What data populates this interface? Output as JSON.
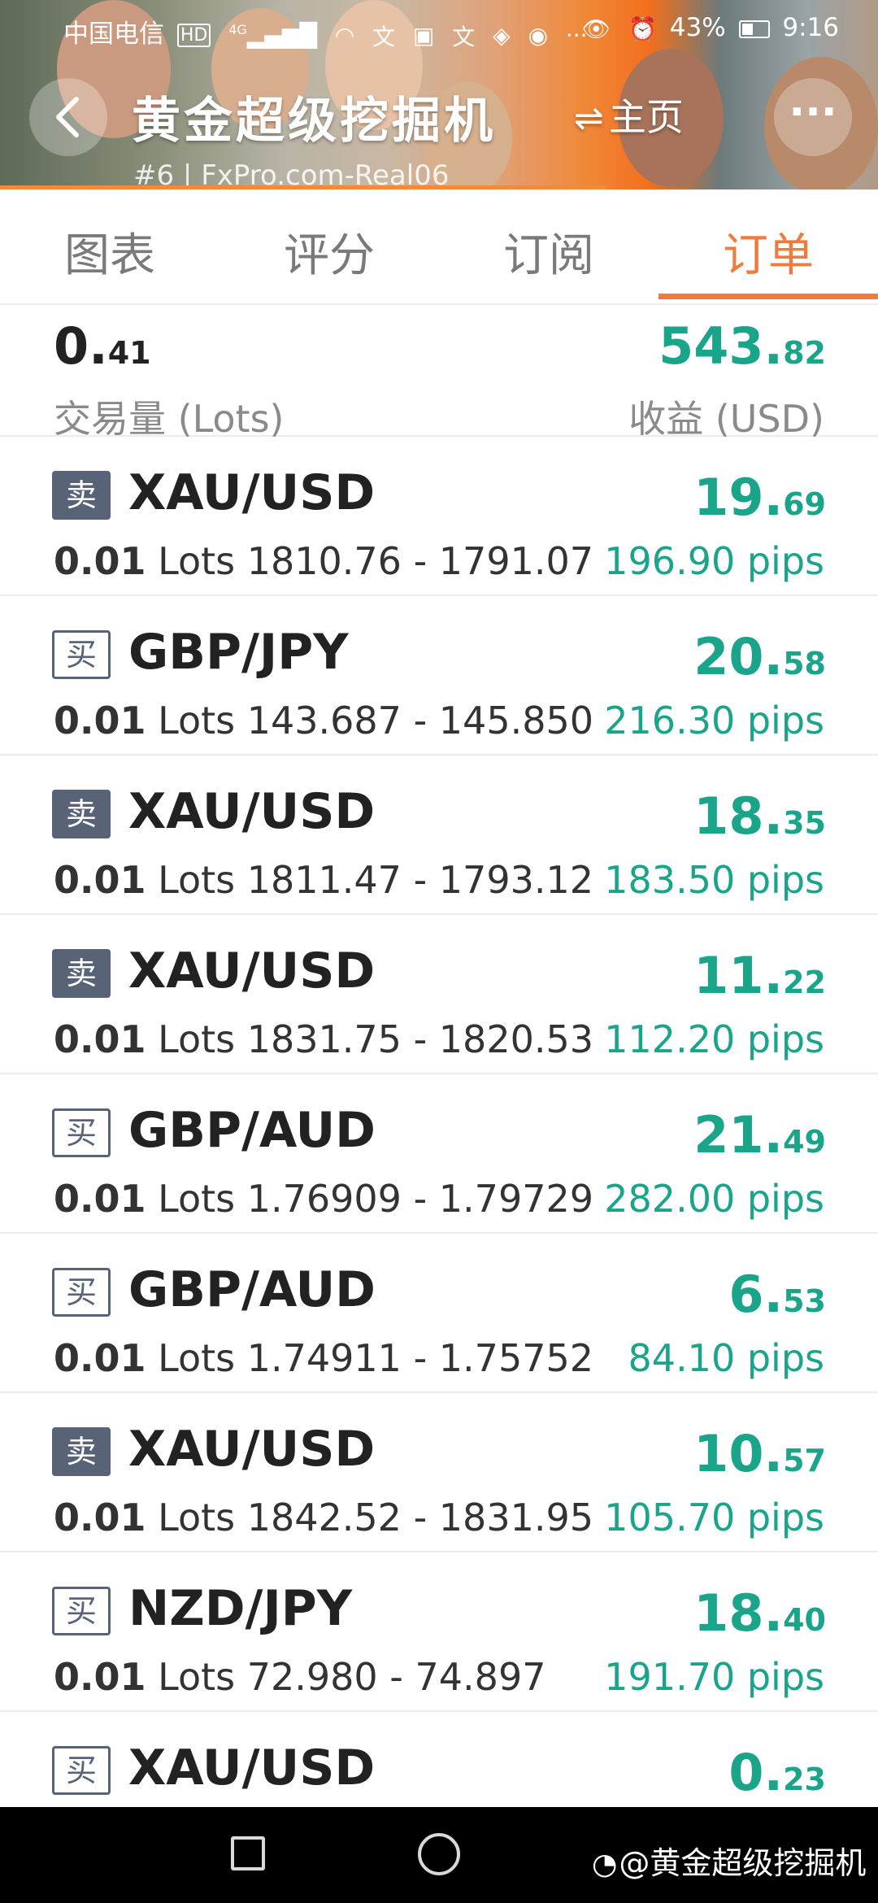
{
  "status_bar": {
    "carrier": "中国电信",
    "hd_badge": "HD",
    "network": "4G",
    "battery": "43%",
    "time": "9:16"
  },
  "header": {
    "title": "黄金超级挖掘机",
    "home_label": "主页",
    "account": "#6 | FxPro.com-Real06"
  },
  "tabs": [
    {
      "label": "图表"
    },
    {
      "label": "评分"
    },
    {
      "label": "订阅"
    },
    {
      "label": "订单"
    }
  ],
  "summary": {
    "lots_int": "0.",
    "lots_dec": "41",
    "lots_label": "交易量 (Lots)",
    "profit_int": "543.",
    "profit_dec": "82",
    "profit_label": "收益 (USD)"
  },
  "orders": [
    {
      "side": "卖",
      "type": "sell",
      "symbol": "XAU/USD",
      "profit_int": "19.",
      "profit_dec": "69",
      "lots": "0.01",
      "lots_unit": "Lots",
      "range": "1810.76 - 1791.07",
      "pips": "196.90 pips"
    },
    {
      "side": "买",
      "type": "buy",
      "symbol": "GBP/JPY",
      "profit_int": "20.",
      "profit_dec": "58",
      "lots": "0.01",
      "lots_unit": "Lots",
      "range": "143.687 - 145.850",
      "pips": "216.30 pips"
    },
    {
      "side": "卖",
      "type": "sell",
      "symbol": "XAU/USD",
      "profit_int": "18.",
      "profit_dec": "35",
      "lots": "0.01",
      "lots_unit": "Lots",
      "range": "1811.47 - 1793.12",
      "pips": "183.50 pips"
    },
    {
      "side": "卖",
      "type": "sell",
      "symbol": "XAU/USD",
      "profit_int": "11.",
      "profit_dec": "22",
      "lots": "0.01",
      "lots_unit": "Lots",
      "range": "1831.75 - 1820.53",
      "pips": "112.20 pips"
    },
    {
      "side": "买",
      "type": "buy",
      "symbol": "GBP/AUD",
      "profit_int": "21.",
      "profit_dec": "49",
      "lots": "0.01",
      "lots_unit": "Lots",
      "range": "1.76909 - 1.79729",
      "pips": "282.00 pips"
    },
    {
      "side": "买",
      "type": "buy",
      "symbol": "GBP/AUD",
      "profit_int": "6.",
      "profit_dec": "53",
      "lots": "0.01",
      "lots_unit": "Lots",
      "range": "1.74911 - 1.75752",
      "pips": "84.10 pips"
    },
    {
      "side": "卖",
      "type": "sell",
      "symbol": "XAU/USD",
      "profit_int": "10.",
      "profit_dec": "57",
      "lots": "0.01",
      "lots_unit": "Lots",
      "range": "1842.52 - 1831.95",
      "pips": "105.70 pips"
    },
    {
      "side": "买",
      "type": "buy",
      "symbol": "NZD/JPY",
      "profit_int": "18.",
      "profit_dec": "40",
      "lots": "0.01",
      "lots_unit": "Lots",
      "range": "72.980 - 74.897",
      "pips": "191.70 pips"
    },
    {
      "side": "买",
      "type": "buy",
      "symbol": "XAU/USD",
      "profit_int": "0.",
      "profit_dec": "23",
      "lots": "",
      "lots_unit": "",
      "range": "",
      "pips": ""
    }
  ],
  "watermark": "@黄金超级挖掘机",
  "colors": {
    "accent": "#f07b3f",
    "profit": "#1aa58a",
    "badge": "#586377"
  }
}
